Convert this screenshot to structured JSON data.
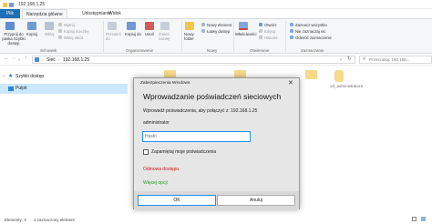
{
  "window": {
    "path": "192.168.1.25"
  },
  "tabs": [
    "Plik",
    "Narzędzia główne",
    "Udostępnianie",
    "Widok"
  ],
  "ribbon": {
    "schowek": {
      "pin": "Przypnij do paska Szybki dostęp",
      "copy": "Kopiuj",
      "paste": "Wklej",
      "cut": "Wytnij",
      "copy_path": "Kopiuj ścieżkę",
      "paste_shortcut": "Wklej skrót",
      "label": "Schowek"
    },
    "organizowanie": {
      "move_to": "Przenieś do",
      "copy_to": "Kopiuj do",
      "delete": "Usuń",
      "rename": "Zmień nazwę",
      "label": "Organizowanie"
    },
    "nowy": {
      "new_folder": "Nowy folder",
      "new_item": "Nowy element",
      "easy_access": "Łatwy dostęp",
      "label": "Nowy"
    },
    "otwieranie": {
      "properties": "Właściwości",
      "open": "Otwórz",
      "edit": "Edytuj",
      "history": "Historia",
      "label": "Otwieranie"
    },
    "zaznaczanie": {
      "select_all": "Zaznacz wszystko",
      "select_none": "Nie zaznaczaj nic",
      "invert": "Odwróć zaznaczenie",
      "label": "Zaznaczanie"
    }
  },
  "nav": {
    "address_parts": [
      "Sieć",
      "192.168.1.25"
    ],
    "search_placeholder": "Przeszukaj: 192.168...",
    "items": [
      "Szybki dostęp",
      "Pulpit"
    ]
  },
  "content": {
    "folders": [
      "od_administratora"
    ]
  },
  "status": {
    "items": "Elementy: 3",
    "selected": "1 zaznaczony element"
  },
  "dialog": {
    "title": "Zabezpieczenia Windows",
    "heading": "Wprowadzanie poświadczeń sieciowych",
    "prompt": "Wprowadź poświadczenia, aby połączyć z: 192.168.1.25",
    "username": "administrator",
    "password_placeholder": "Hasło",
    "remember": "Zapamiętaj moje poświadczenia",
    "error": "Odmowa dostępu.",
    "more_options": "Więcej opcji",
    "ok": "OK",
    "cancel": "Anuluj",
    "close_glyph": "✕"
  },
  "colors": {
    "accent": "#1f6fb5",
    "error": "#d01414",
    "link": "#1a9e1a",
    "selection": "#cce8ff"
  }
}
